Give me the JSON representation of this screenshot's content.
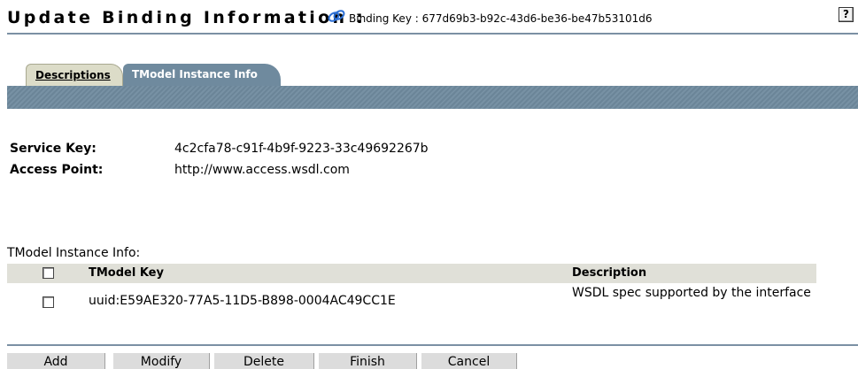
{
  "header": {
    "title": "Update Binding Information :",
    "binding_key_text": "Binding Key : 677d69b3-b92c-43d6-be36-be47b53101d6",
    "help_label": "?"
  },
  "tabs": [
    {
      "label": "Descriptions",
      "active": false
    },
    {
      "label": "TModel Instance Info",
      "active": true
    }
  ],
  "service": {
    "service_key_label": "Service Key:",
    "service_key_value": "4c2cfa78-c91f-4b9f-9223-33c49692267b",
    "access_point_label": "Access Point:",
    "access_point_value": "http://www.access.wsdl.com"
  },
  "tmodel_section": {
    "label": "TModel Instance Info:",
    "columns": [
      "TModel Key",
      "Description"
    ],
    "rows": [
      {
        "tmodel_key": "uuid:E59AE320-77A5-11D5-B898-0004AC49CC1E",
        "description": "WSDL spec supported by the interface"
      }
    ]
  },
  "buttons": [
    "Add",
    "Modify",
    "Delete",
    "Finish",
    "Cancel"
  ],
  "colors": {
    "accent": "#6f8a9e",
    "rule": "#7b90a4",
    "table_header": "#e0e0d8",
    "button": "#dcdcdc"
  },
  "icons": {
    "binding": "binding-link-icon",
    "help": "help-icon"
  }
}
